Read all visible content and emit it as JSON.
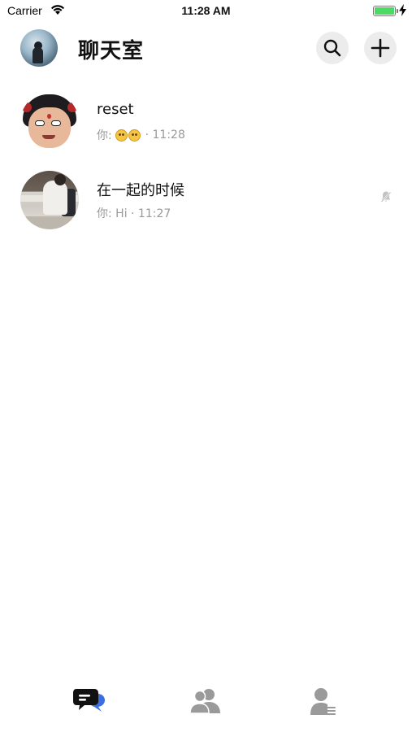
{
  "status_bar": {
    "carrier": "Carrier",
    "time": "11:28 AM",
    "battery_level": 1.0
  },
  "header": {
    "title": "聊天室",
    "avatar_icon": "user-avatar",
    "search_icon": "search-icon",
    "add_icon": "plus-icon"
  },
  "chats": [
    {
      "name": "reset",
      "preview_prefix": "你: ",
      "preview_emoji_count": 2,
      "preview_suffix": " · 11:28",
      "muted": false
    },
    {
      "name": "在一起的时候",
      "preview": "你: Hi · 11:27",
      "muted": true
    }
  ],
  "tab_bar": {
    "tabs": [
      {
        "icon": "chat-bubbles-icon",
        "active": true
      },
      {
        "icon": "contacts-icon",
        "active": false
      },
      {
        "icon": "profile-icon",
        "active": false
      }
    ]
  },
  "colors": {
    "title": "#111111",
    "preview": "#999999",
    "icon_button_bg": "#ececec",
    "tab_active": "#111111",
    "tab_accent": "#3b6fe0",
    "tab_inactive": "#9a9a9a"
  }
}
